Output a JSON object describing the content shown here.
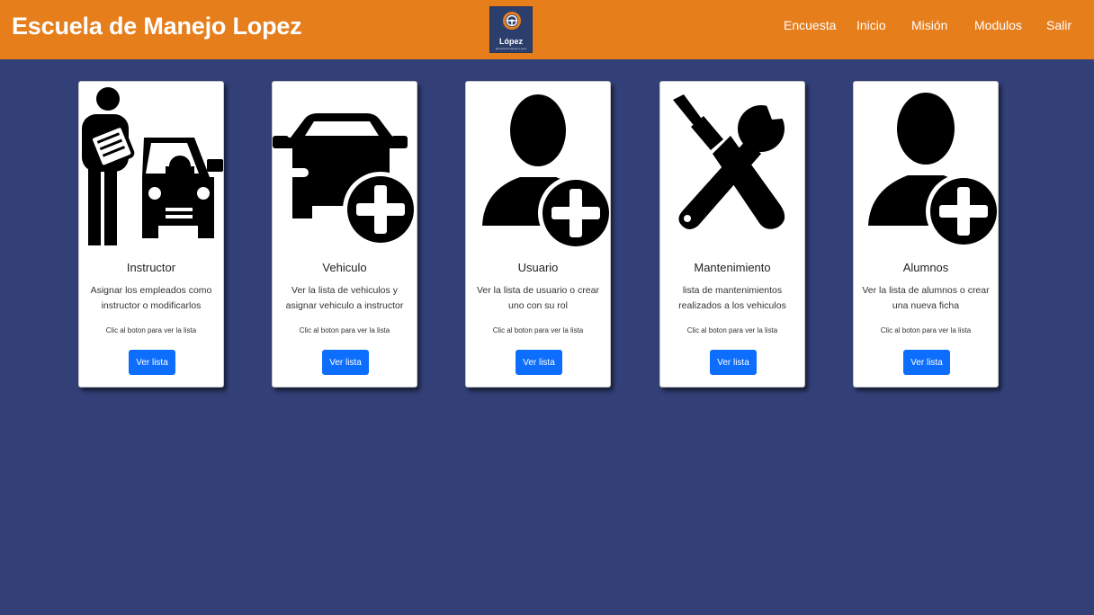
{
  "header": {
    "brand": "Escuela de Manejo Lopez",
    "logo": {
      "name": "López",
      "subtitle": "Escuela de Manejo Lopez",
      "icon": "steering-wheel-icon"
    },
    "nav": [
      "Encuesta",
      "Inicio",
      "Misión",
      "Modulos",
      "Salir"
    ]
  },
  "colors": {
    "header": "#e67e1c",
    "background": "#334078",
    "button": "#0d6efd"
  },
  "cards": [
    {
      "icon": "instructor-car-icon",
      "title": "Instructor",
      "text": "Asignar los empleados como instructor o modificarlos",
      "note": "Clic al boton para ver la lista",
      "button": "Ver lista"
    },
    {
      "icon": "car-add-icon",
      "title": "Vehiculo",
      "text": "Ver la lista de vehiculos y asignar vehiculo a instructor",
      "note": "Clic al boton para ver la lista",
      "button": "Ver lista"
    },
    {
      "icon": "user-add-icon",
      "title": "Usuario",
      "text": "Ver la lista de usuario o crear uno con su rol",
      "note": "Clic al boton para ver la lista",
      "button": "Ver lista"
    },
    {
      "icon": "tools-icon",
      "title": "Mantenimiento",
      "text": "lista de mantenimientos realizados a los vehiculos",
      "note": "Clic al boton para ver la lista",
      "button": "Ver lista"
    },
    {
      "icon": "student-add-icon",
      "title": "Alumnos",
      "text": "Ver la lista de alumnos o crear una nueva ficha",
      "note": "Clic al boton para ver la lista",
      "button": "Ver lista"
    }
  ]
}
